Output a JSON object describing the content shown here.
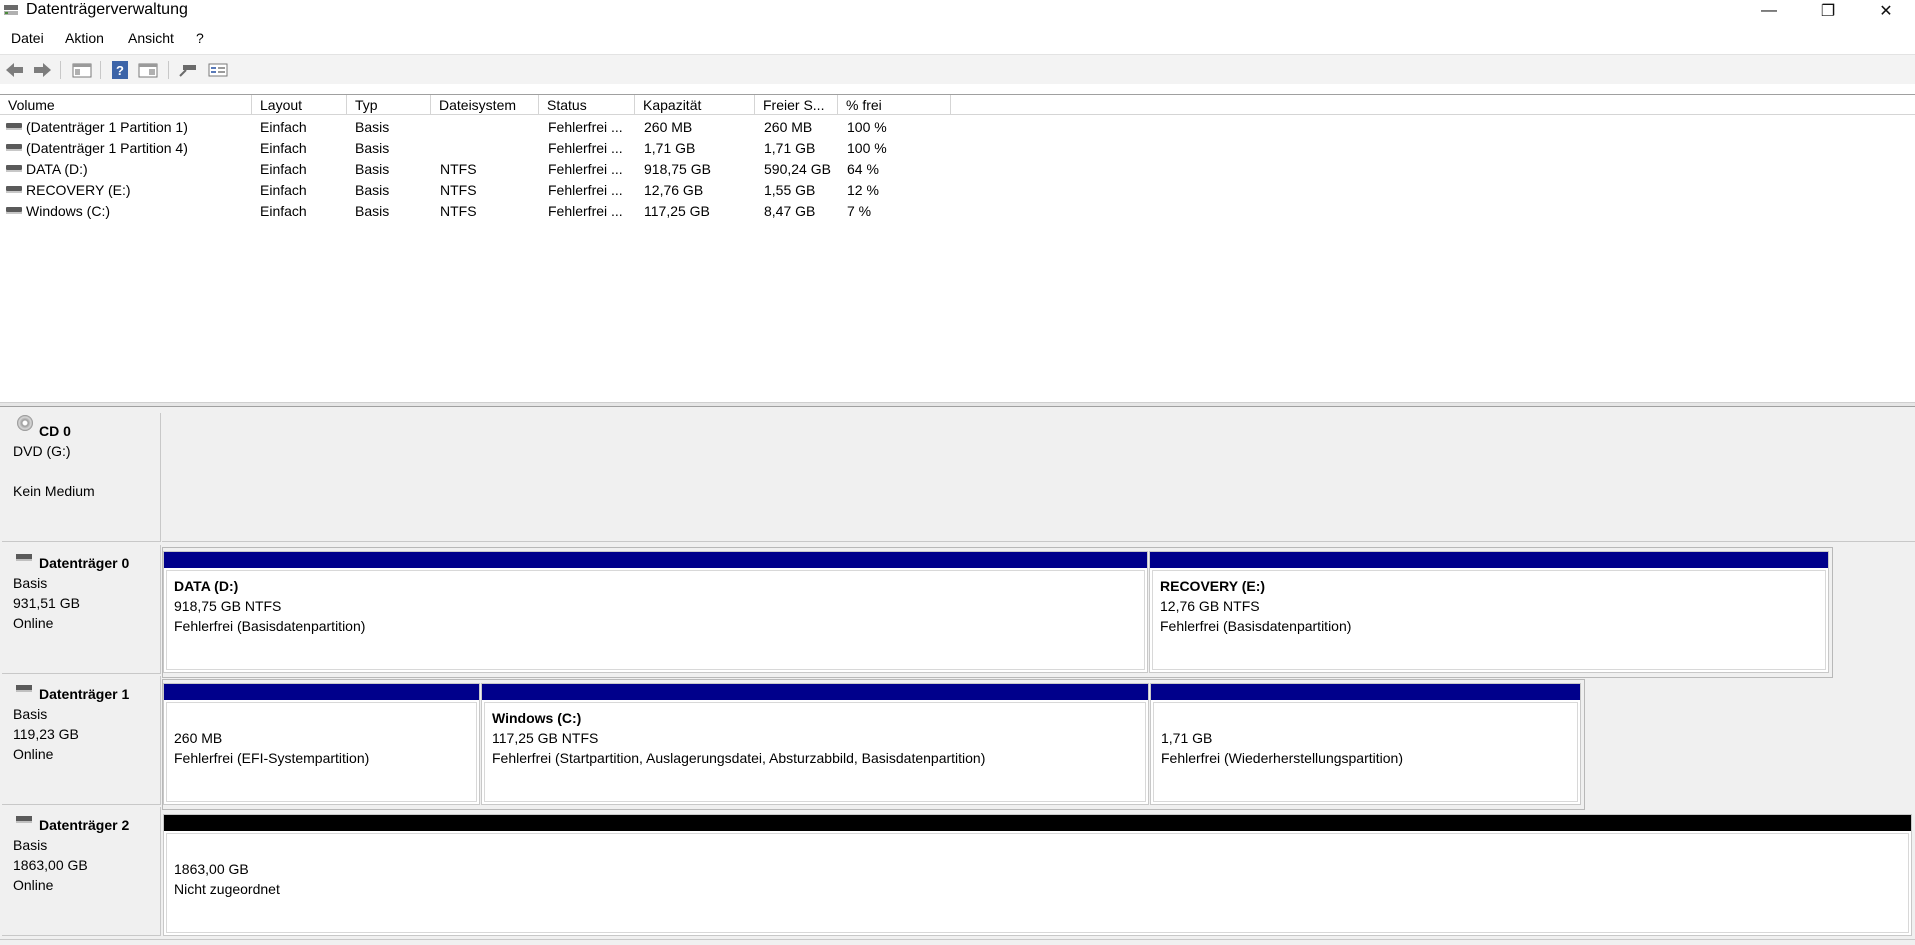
{
  "window": {
    "title": "Datenträgerverwaltung",
    "min_glyph": "—",
    "max_glyph": "❐",
    "close_glyph": "✕"
  },
  "menu": [
    "Datei",
    "Aktion",
    "Ansicht",
    "?"
  ],
  "toolbar": {
    "icons": [
      "back-arrow-icon",
      "forward-arrow-icon",
      "console-tree-icon",
      "help-icon",
      "properties-icon",
      "connect-icon",
      "disk-list-icon"
    ]
  },
  "volumes": {
    "columns": [
      "Volume",
      "Layout",
      "Typ",
      "Dateisystem",
      "Status",
      "Kapazität",
      "Freier S...",
      "% frei"
    ],
    "rows": [
      [
        "(Datenträger 1 Partition 1)",
        "Einfach",
        "Basis",
        "",
        "Fehlerfrei ...",
        "260 MB",
        "260 MB",
        "100 %"
      ],
      [
        "(Datenträger 1 Partition 4)",
        "Einfach",
        "Basis",
        "",
        "Fehlerfrei ...",
        "1,71 GB",
        "1,71 GB",
        "100 %"
      ],
      [
        "DATA (D:)",
        "Einfach",
        "Basis",
        "NTFS",
        "Fehlerfrei ...",
        "918,75 GB",
        "590,24 GB",
        "64 %"
      ],
      [
        "RECOVERY (E:)",
        "Einfach",
        "Basis",
        "NTFS",
        "Fehlerfrei ...",
        "12,76 GB",
        "1,55 GB",
        "12 %"
      ],
      [
        "Windows (C:)",
        "Einfach",
        "Basis",
        "NTFS",
        "Fehlerfrei ...",
        "117,25 GB",
        "8,47 GB",
        "7 %"
      ]
    ]
  },
  "disks": {
    "cd0": {
      "name": "CD 0",
      "line1": "DVD (G:)",
      "line2": "",
      "line3": "Kein Medium"
    },
    "disk0": {
      "name": "Datenträger 0",
      "type": "Basis",
      "size": "931,51 GB",
      "state": "Online",
      "partitions": [
        {
          "name": "DATA  (D:)",
          "size": "918,75 GB NTFS",
          "status": "Fehlerfrei (Basisdatenpartition)"
        },
        {
          "name": "RECOVERY  (E:)",
          "size": "12,76 GB NTFS",
          "status": "Fehlerfrei (Basisdatenpartition)"
        }
      ]
    },
    "disk1": {
      "name": "Datenträger 1",
      "type": "Basis",
      "size": "119,23 GB",
      "state": "Online",
      "partitions": [
        {
          "name": "",
          "size": "260 MB",
          "status": "Fehlerfrei (EFI-Systempartition)"
        },
        {
          "name": "Windows  (C:)",
          "size": "117,25 GB NTFS",
          "status": "Fehlerfrei (Startpartition, Auslagerungsdatei, Absturzabbild, Basisdatenpartition)"
        },
        {
          "name": "",
          "size": "1,71 GB",
          "status": "Fehlerfrei (Wiederherstellungspartition)"
        }
      ]
    },
    "disk2": {
      "name": "Datenträger 2",
      "type": "Basis",
      "size": "1863,00 GB",
      "state": "Online",
      "partitions": [
        {
          "size": "1863,00 GB",
          "status": "Nicht zugeordnet"
        }
      ]
    }
  },
  "colors": {
    "primary_partition": "#00008b",
    "unallocated": "#000000"
  }
}
